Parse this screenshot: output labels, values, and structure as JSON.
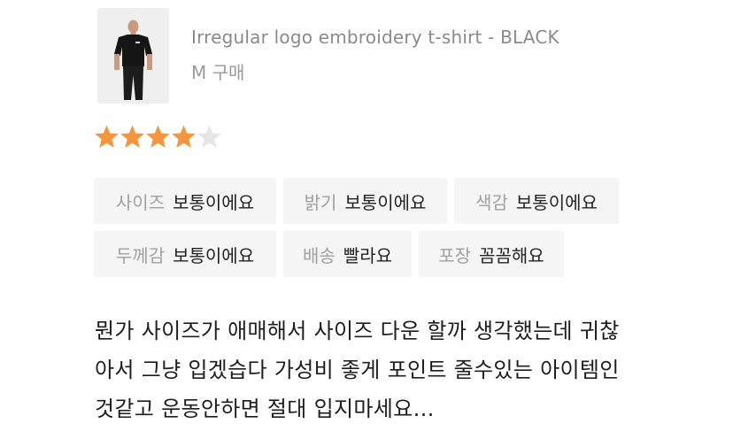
{
  "product": {
    "name": "Irregular logo embroidery t-shirt - BLACK",
    "option": "M  구매"
  },
  "rating": {
    "value": 4,
    "max": 5,
    "filled_color": "#f5953d",
    "empty_color": "#e6e6e6"
  },
  "tags": [
    {
      "key": "사이즈",
      "value": "보통이에요"
    },
    {
      "key": "밝기",
      "value": "보통이에요"
    },
    {
      "key": "색감",
      "value": "보통이에요"
    },
    {
      "key": "두께감",
      "value": "보통이에요"
    },
    {
      "key": "배송",
      "value": "빨라요"
    },
    {
      "key": "포장",
      "value": "꼼꼼해요"
    }
  ],
  "review": {
    "lines": [
      "뭔가 사이즈가 애매해서 사이즈 다운 할까 생각했는데 귀찮",
      "아서 그냥 입겠습다 가성비 좋게 포인트 줄수있는 아이템인",
      "것같고 운동안하면 절대 입지마세요…"
    ]
  }
}
